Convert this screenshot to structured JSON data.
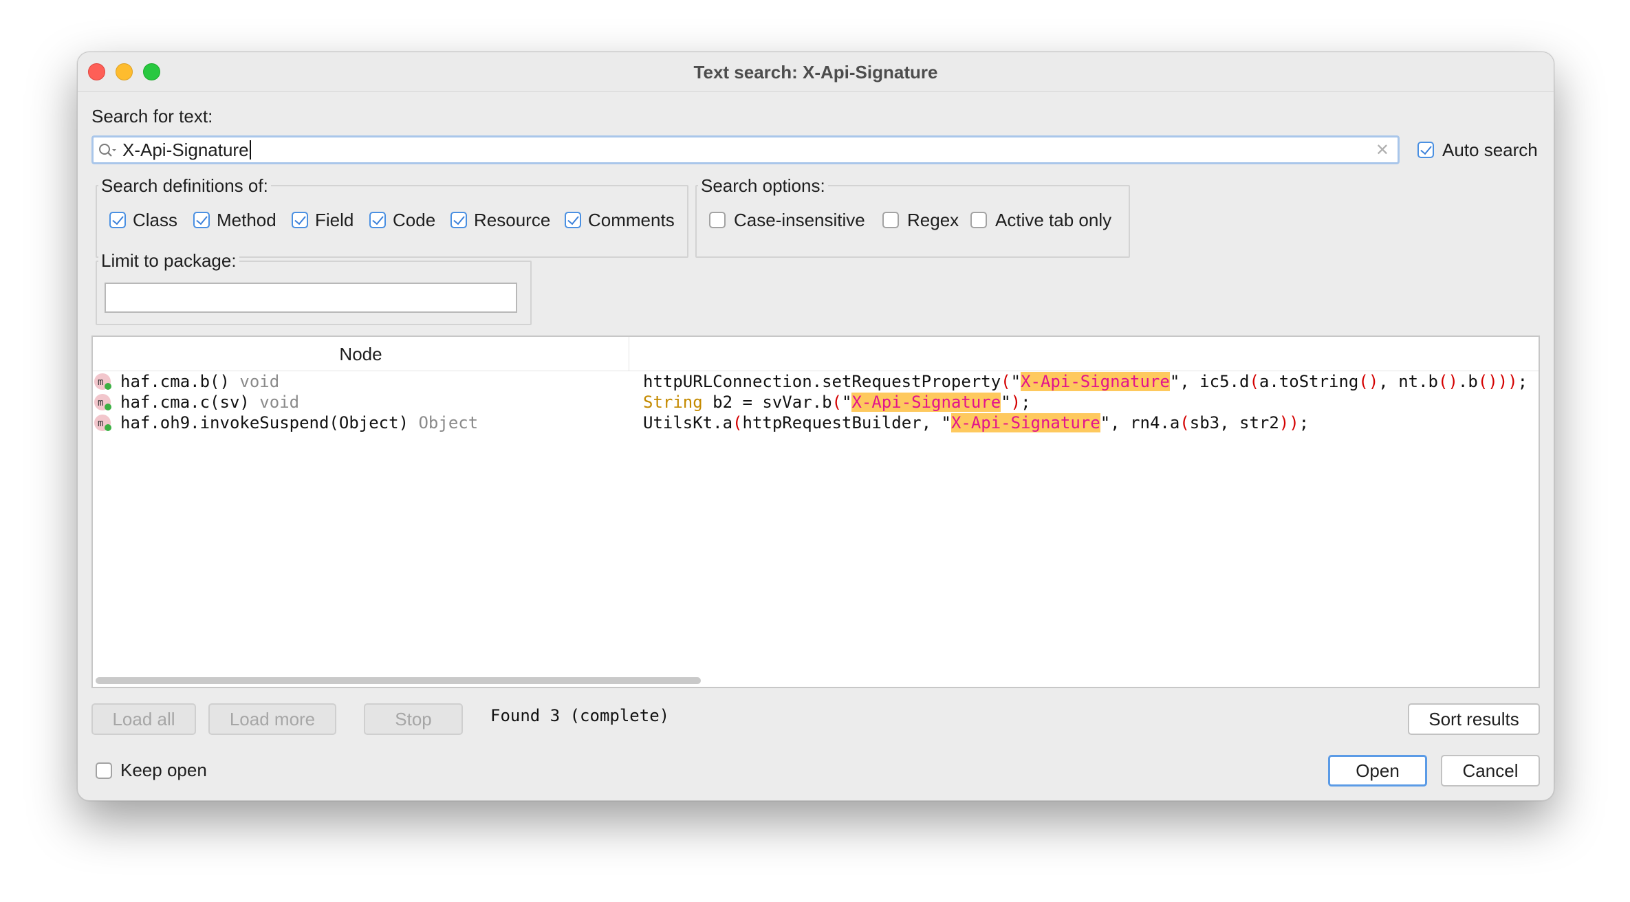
{
  "window": {
    "title": "Text search: X-Api-Signature"
  },
  "search": {
    "label": "Search for text:",
    "value": "X-Api-Signature",
    "auto_search_label": "Auto search",
    "auto_search_checked": true
  },
  "definitions": {
    "title": "Search definitions of:",
    "items": [
      {
        "label": "Class",
        "checked": true
      },
      {
        "label": "Method",
        "checked": true
      },
      {
        "label": "Field",
        "checked": true
      },
      {
        "label": "Code",
        "checked": true
      },
      {
        "label": "Resource",
        "checked": true
      },
      {
        "label": "Comments",
        "checked": true
      }
    ]
  },
  "options": {
    "title": "Search options:",
    "items": [
      {
        "label": "Case-insensitive",
        "checked": false
      },
      {
        "label": "Regex",
        "checked": false
      },
      {
        "label": "Active tab only",
        "checked": false
      }
    ]
  },
  "package": {
    "title": "Limit to package:",
    "value": ""
  },
  "results": {
    "column_node": "Node",
    "icon_letter": "m",
    "rows": [
      {
        "node": "haf.cma.b()",
        "type": "void",
        "code_pre": "httpURLConnection.setRequestProperty",
        "code_p1": "(",
        "code_q1": "\"",
        "code_match": "X-Api-Signature",
        "code_q2": "\"",
        "code_mid": ", ic5.d",
        "code_p2": "(",
        "code_mid2": "a.toString",
        "code_p3": "()",
        "code_mid3": ", nt.b",
        "code_p4": "()",
        "code_mid4": ".b",
        "code_p5": "()))",
        "code_end": ";"
      },
      {
        "node": "haf.cma.c(sv)",
        "type": "void",
        "code_kw": "String",
        "code_pre": " b2 = svVar.b",
        "code_p1": "(",
        "code_q1": "\"",
        "code_match": "X-Api-Signature",
        "code_q2": "\"",
        "code_p2": ")",
        "code_end": ";"
      },
      {
        "node": "haf.oh9.invokeSuspend(Object)",
        "type": "Object",
        "code_pre": "UtilsKt.a",
        "code_p1": "(",
        "code_mid": "httpRequestBuilder, ",
        "code_q1": "\"",
        "code_match": "X-Api-Signature",
        "code_q2": "\"",
        "code_mid2": ", rn4.a",
        "code_p2": "(",
        "code_mid3": "sb3, str2",
        "code_p3": "))",
        "code_end": ";"
      }
    ]
  },
  "footer": {
    "load_all": "Load all",
    "load_more": "Load more",
    "stop": "Stop",
    "status": "Found 3 (complete)",
    "sort_results": "Sort results",
    "keep_open_label": "Keep open",
    "keep_open_checked": false,
    "open": "Open",
    "cancel": "Cancel"
  },
  "colors": {
    "highlight_bg": "#fec95e",
    "highlight_fg": "#e2138c",
    "paren": "#d40000",
    "keyword": "#c48a00",
    "accent": "#4a90e2"
  },
  "icons": [
    "search-icon",
    "clear-icon",
    "method-icon"
  ]
}
